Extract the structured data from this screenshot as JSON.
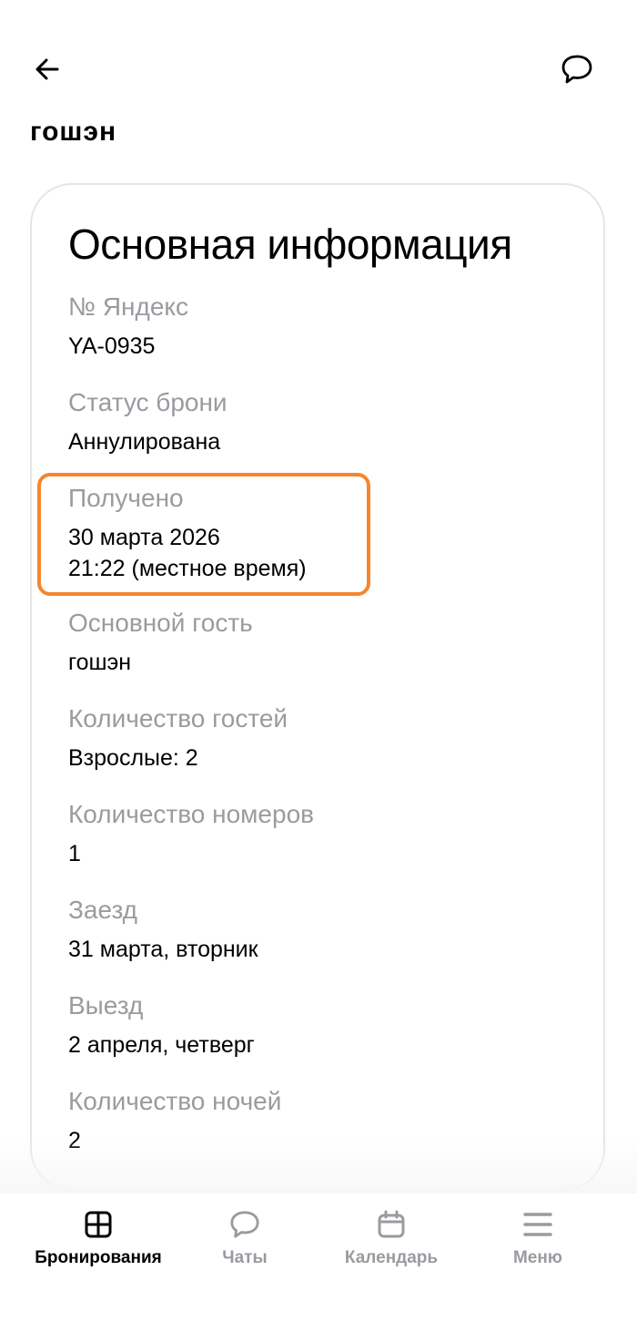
{
  "header": {
    "guest_name": "гошэн"
  },
  "card": {
    "title": "Основная информация",
    "fields": [
      {
        "label": "№ Яндекс",
        "value": "YA-0935"
      },
      {
        "label": "Статус брони",
        "value": "Аннулирована"
      },
      {
        "label": "Получено",
        "value": "30 марта 2026",
        "value2": "21:22 (местное время)"
      },
      {
        "label": "Основной гость",
        "value": "гошэн"
      },
      {
        "label": "Количество гостей",
        "value": "Взрослые: 2"
      },
      {
        "label": "Количество номеров",
        "value": "1"
      },
      {
        "label": "Заезд",
        "value": "31 марта, вторник"
      },
      {
        "label": "Выезд",
        "value": "2 апреля, четверг"
      },
      {
        "label": "Количество ночей",
        "value": "2"
      }
    ]
  },
  "tabs": [
    {
      "label": "Бронирования",
      "icon": "grid-icon",
      "active": true
    },
    {
      "label": "Чаты",
      "icon": "chat-bubble-icon",
      "active": false
    },
    {
      "label": "Календарь",
      "icon": "calendar-icon",
      "active": false
    },
    {
      "label": "Меню",
      "icon": "menu-icon",
      "active": false
    }
  ],
  "colors": {
    "highlight": "#f5862e",
    "label_gray": "#9a9ba0"
  }
}
